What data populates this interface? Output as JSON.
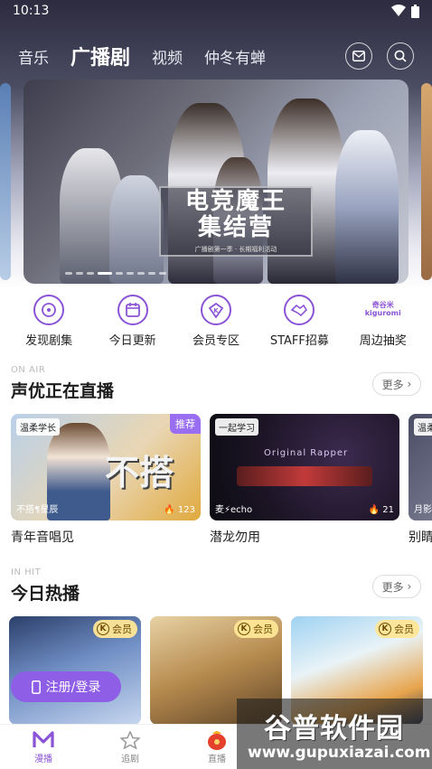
{
  "status": {
    "time": "10:13"
  },
  "nav": {
    "tabs": [
      "音乐",
      "广播剧",
      "视频",
      "仲冬有蝉"
    ],
    "active_tab": "广播剧"
  },
  "banner": {
    "title_line1": "电竞魔王",
    "title_line2": "集结营",
    "subtitle": "广播剧第一季 · 长期福利活动",
    "slide_count": 9,
    "active_slide": 3
  },
  "quick_entries": [
    {
      "label": "发现剧集",
      "icon": "disc-icon"
    },
    {
      "label": "今日更新",
      "icon": "calendar-icon"
    },
    {
      "label": "会员专区",
      "icon": "vip-k-icon"
    },
    {
      "label": "STAFF招募",
      "icon": "handshake-icon"
    },
    {
      "label": "周边抽奖",
      "icon": "kiguri-logo",
      "icon_text": "奇谷米\nkiguromi"
    }
  ],
  "live_section": {
    "sub": "ON AIR",
    "title": "声优正在直播",
    "more": "更多",
    "cards": [
      {
        "tag": "温柔学长",
        "recommend": "推荐",
        "cover_text": "不搭",
        "host": "不搭¶星辰",
        "count": "123",
        "name": "青年音唱见"
      },
      {
        "tag": "一起学习",
        "cover_text": "Original Rapper",
        "host": "麦⚡echo",
        "count": "21",
        "name": "潜龙勿用"
      },
      {
        "tag": "温柔",
        "host": "月影",
        "name": "别睛"
      }
    ]
  },
  "hot_section": {
    "sub": "IN HIT",
    "title": "今日热播",
    "more": "更多",
    "vip_label": "会员",
    "vip_k": "K"
  },
  "login": {
    "label": "注册/登录"
  },
  "bottom_nav": [
    {
      "label": "漫播",
      "active": true
    },
    {
      "label": "追剧",
      "active": false
    },
    {
      "label": "直播",
      "active": false
    }
  ],
  "watermark": {
    "main": "谷普软件园",
    "url": "www.gupuxiazai.com"
  },
  "colors": {
    "accent": "#8b54d6",
    "vip_gold": "#ffe696"
  }
}
